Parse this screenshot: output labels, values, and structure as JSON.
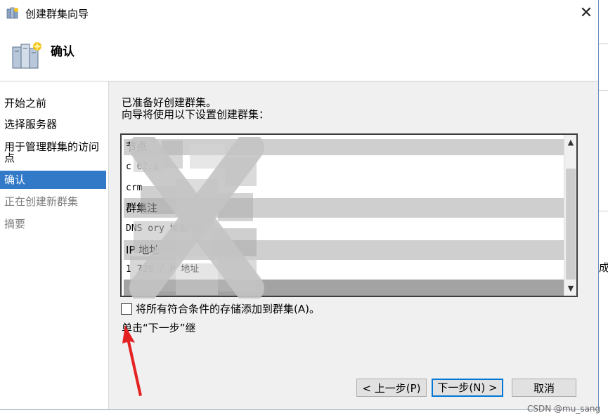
{
  "window": {
    "title": "创建群集向导",
    "close_glyph": "✕",
    "page_title": "确认",
    "icons": [
      "cluster-wizard-icon",
      "cluster-servers-icon",
      "close-icon"
    ]
  },
  "nav": {
    "items": [
      {
        "label": "开始之前",
        "state": "normal"
      },
      {
        "label": "选择服务器",
        "state": "normal"
      },
      {
        "label": "用于管理群集的访问",
        "label2": "点",
        "state": "normal"
      },
      {
        "label": "确认",
        "state": "active"
      },
      {
        "label": "正在创建新群集",
        "state": "disabled"
      },
      {
        "label": "摘要",
        "state": "disabled"
      }
    ]
  },
  "content": {
    "ready_line1": "已准备好创建群集。",
    "ready_line2": "向导将使用以下设置创建群集：",
    "list": {
      "rows": [
        {
          "type": "group",
          "text": "节点"
        },
        {
          "type": "item",
          "text": "c        02.a"
        },
        {
          "type": "item",
          "text": "crm"
        },
        {
          "type": "group",
          "text": "群集注"
        },
        {
          "type": "item",
          "text": "DNS              ory 域服务"
        },
        {
          "type": "group",
          "text": "IP 地址"
        },
        {
          "type": "item",
          "text": "1          728 /       P 地址"
        }
      ],
      "scroll_up": "▲",
      "scroll_down": "▼"
    },
    "checkbox_label": "将所有符合条件的存储添加到群集(A)。",
    "checkbox_checked": false,
    "hint": "单击“下一步”继"
  },
  "buttons": {
    "back": "< 上一步(P)",
    "next": "下一步(N) >",
    "cancel": "取消"
  },
  "watermark": "CSDN @mu_sang",
  "right_strip_char": "成",
  "colors": {
    "accent": "#3279c8",
    "default_button_border": "#0078d7",
    "arrow": "#e52222"
  }
}
